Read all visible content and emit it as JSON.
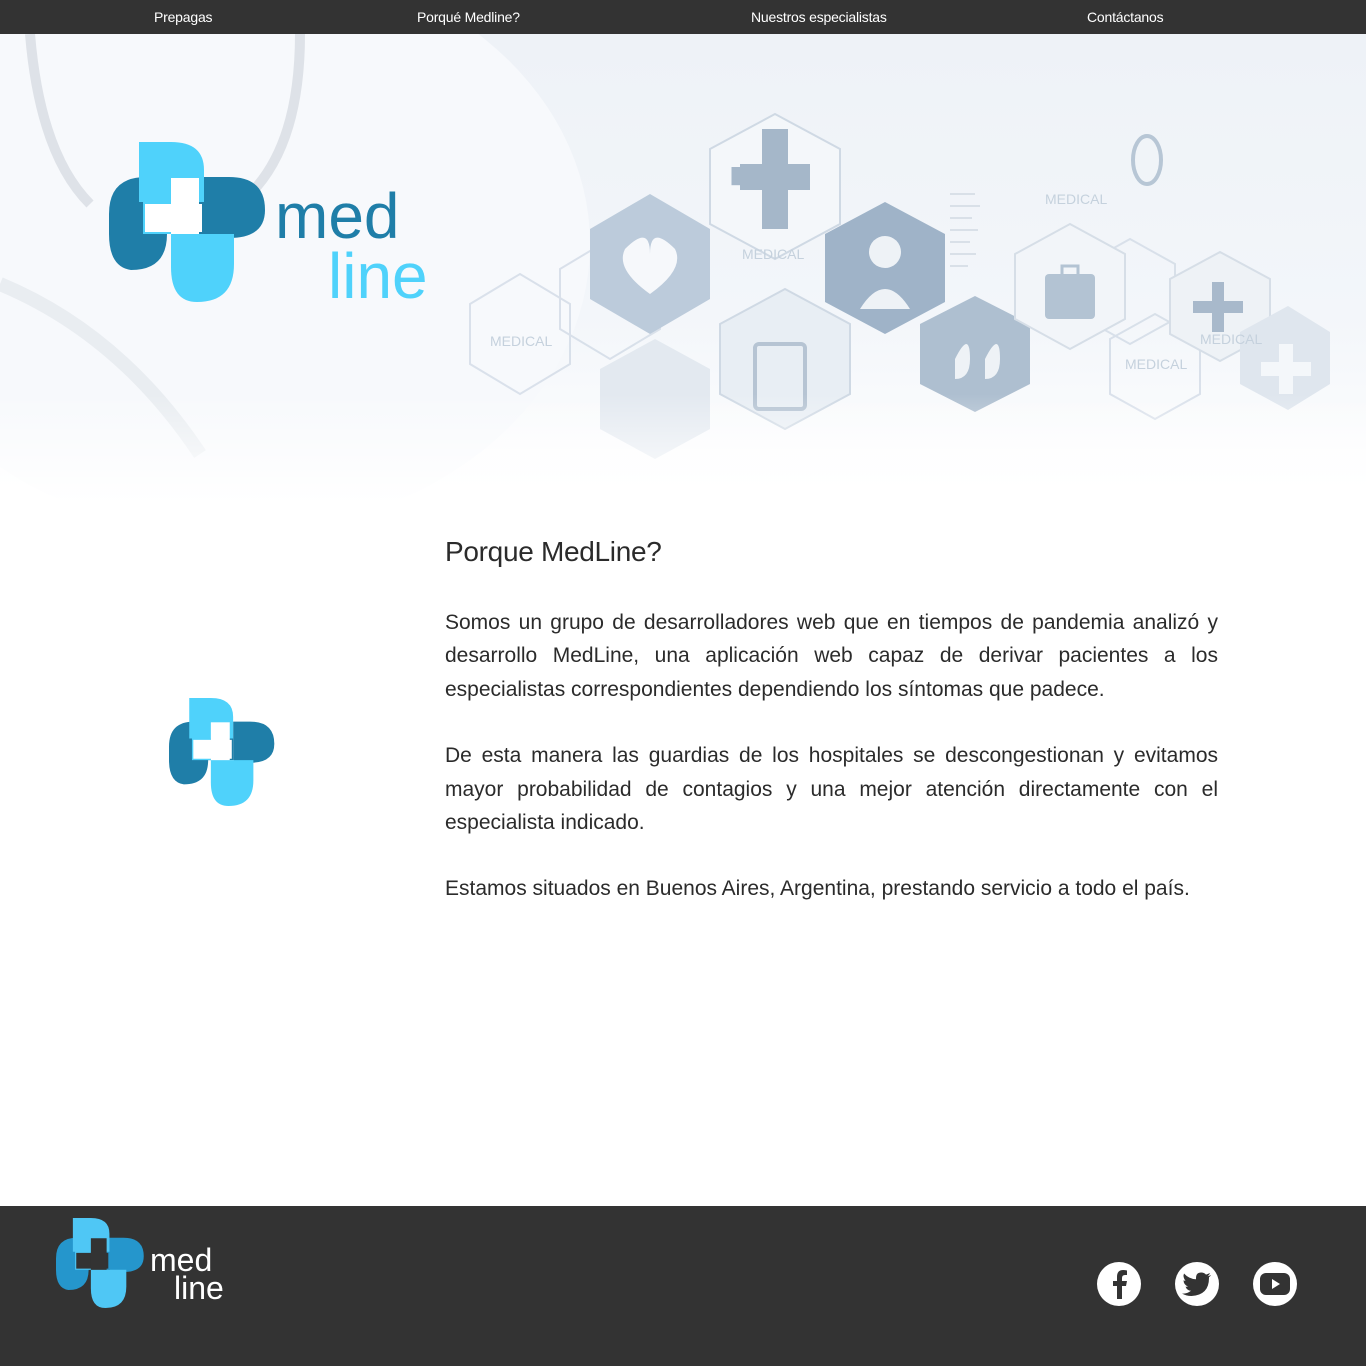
{
  "nav": {
    "items": [
      {
        "label": "Prepagas"
      },
      {
        "label": "Porqué Medline?"
      },
      {
        "label": "Nuestros especialistas"
      },
      {
        "label": "Contáctanos"
      }
    ]
  },
  "hero": {
    "logo": {
      "word_top": "med",
      "word_bottom": "line"
    },
    "illustration_labels": [
      "MEDICAL",
      "MEDICAL",
      "MEDICAL",
      "MEDICAL",
      "MEDICAL"
    ]
  },
  "about": {
    "title": "Porque MedLine?",
    "paragraphs": [
      "Somos un grupo de desarrolladores web que en tiempos de pandemia analizó y desarrollo MedLine, una aplicación web capaz de derivar pacientes a los especialistas correspondientes dependiendo los síntomas que padece.",
      "De esta manera las guardias de los hospitales se descongestionan y evitamos mayor probabilidad de contagios y una mejor atención directamente con el especialista indicado.",
      "Estamos situados en Buenos Aires, Argentina, prestando servicio a todo el país."
    ]
  },
  "footer": {
    "logo": {
      "word_top": "med",
      "word_bottom": "line"
    },
    "social": [
      {
        "icon": "facebook-icon"
      },
      {
        "icon": "twitter-icon"
      },
      {
        "icon": "youtube-icon"
      }
    ]
  },
  "colors": {
    "nav_bg": "#333333",
    "brand_dark": "#1f7ea8",
    "brand_light": "#4fd2fb",
    "footer_bg": "#333333"
  }
}
